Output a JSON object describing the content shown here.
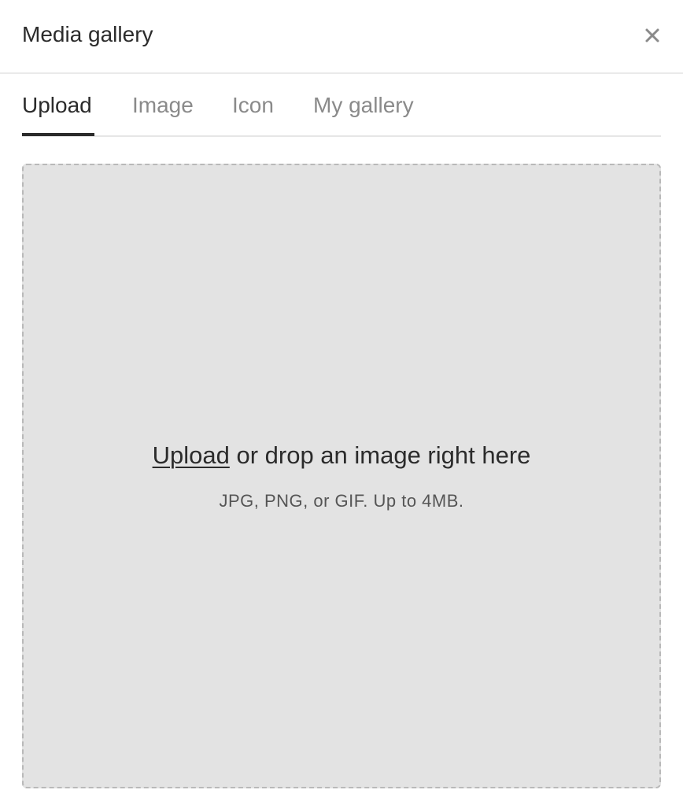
{
  "dialog": {
    "title": "Media gallery",
    "close_icon": "close-icon"
  },
  "tabs": [
    {
      "label": "Upload",
      "active": true
    },
    {
      "label": "Image",
      "active": false
    },
    {
      "label": "Icon",
      "active": false
    },
    {
      "label": "My gallery",
      "active": false
    }
  ],
  "dropzone": {
    "link_label": "Upload",
    "main_text": " or drop an image right here",
    "hint": "JPG, PNG, or GIF. Up to 4MB."
  },
  "colors": {
    "text_primary": "#2b2b2b",
    "text_muted": "#8a8a8a",
    "dropzone_bg": "#e3e3e3",
    "dropzone_border": "#b9b9b9"
  }
}
